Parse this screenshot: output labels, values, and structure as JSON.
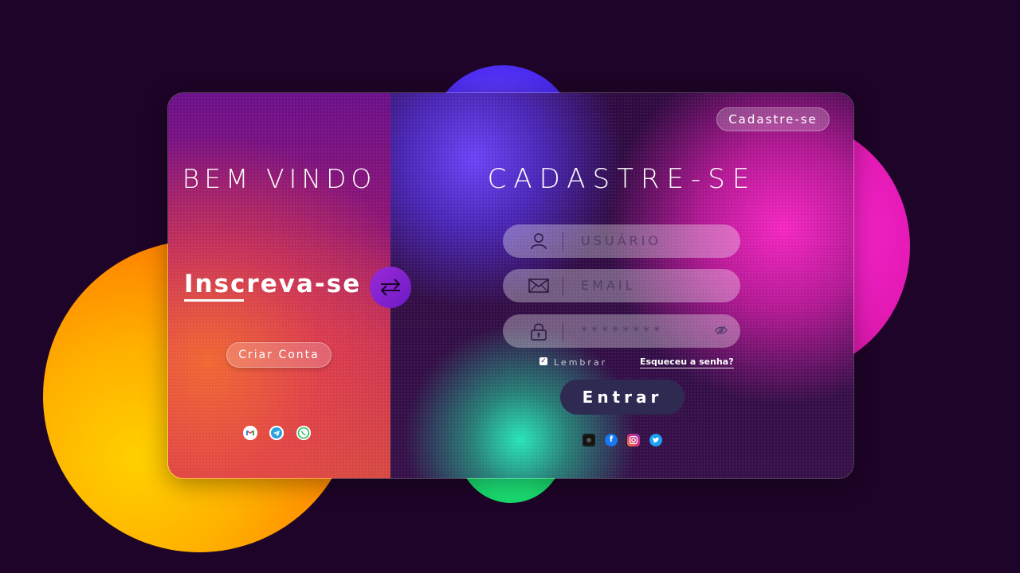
{
  "colors": {
    "background": "#1e0428",
    "orange_blob": "#ffb100",
    "pink_blob": "#e61bb7",
    "blue_blob": "#4b2cf0",
    "green_blob": "#1de276",
    "login_button": "#2f2a52",
    "swap_button": "#8a24d0"
  },
  "left_panel": {
    "welcome": "BEM VINDO",
    "subscribe": "Inscreva-se",
    "create_account": "Criar Conta",
    "social_icons": [
      "gmail-icon",
      "telegram-icon",
      "whatsapp-icon"
    ]
  },
  "swap_icon": "swap-arrows-icon",
  "right_panel": {
    "top_button": "Cadastre-se",
    "title": "CADASTRE-SE",
    "fields": [
      {
        "icon": "user-icon",
        "placeholder": "USUÁRIO"
      },
      {
        "icon": "mail-icon",
        "placeholder": "EMAIL"
      },
      {
        "icon": "lock-icon",
        "placeholder": "********",
        "trailing_icon": "eye-off-icon"
      }
    ],
    "remember": "Lembrar",
    "forgot": "Esqueceu a senha?",
    "login": "Entrar",
    "social_icons": [
      "github-icon",
      "facebook-icon",
      "instagram-icon",
      "twitter-icon"
    ]
  }
}
